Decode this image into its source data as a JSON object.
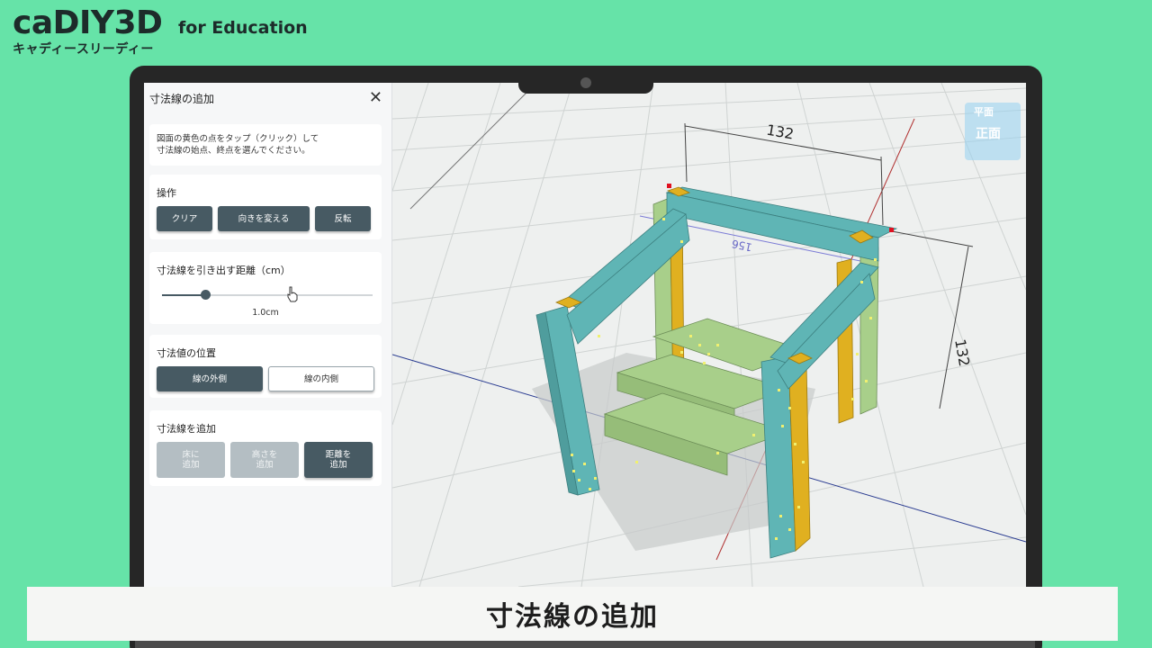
{
  "brand": {
    "title": "caDIY3D",
    "subtitle": "for Education",
    "kana": "キャディースリーディー"
  },
  "panel": {
    "title": "寸法線の追加",
    "instruction_line1": "図面の黄色の点をタップ（クリック）して",
    "instruction_line2": "寸法線の始点、終点を選んでください。",
    "operations": {
      "label": "操作",
      "clear": "クリア",
      "change_direction": "向きを変える",
      "flip": "反転"
    },
    "distance": {
      "label": "寸法線を引き出す距離（cm）",
      "value": "1.0cm",
      "fraction": 0.21
    },
    "value_position": {
      "label": "寸法値の位置",
      "outside": "線の外側",
      "inside": "線の内側"
    },
    "add": {
      "label": "寸法線を追加",
      "floor": "床に\n追加",
      "height": "高さを\n追加",
      "distance": "距離を\n追加"
    }
  },
  "viewport": {
    "dimension_top": "132",
    "dimension_right": "132",
    "dimension_back": "156",
    "view_cube_top": "平面",
    "view_cube_front": "正面",
    "colors": {
      "leg": "#5fb5b5",
      "rail": "#e0b020",
      "shelf": "#a8cf8a",
      "point": "#f0f070",
      "axis_red": "#b03030",
      "axis_blue": "#283a90"
    }
  },
  "caption": {
    "text": "寸法線の追加"
  }
}
